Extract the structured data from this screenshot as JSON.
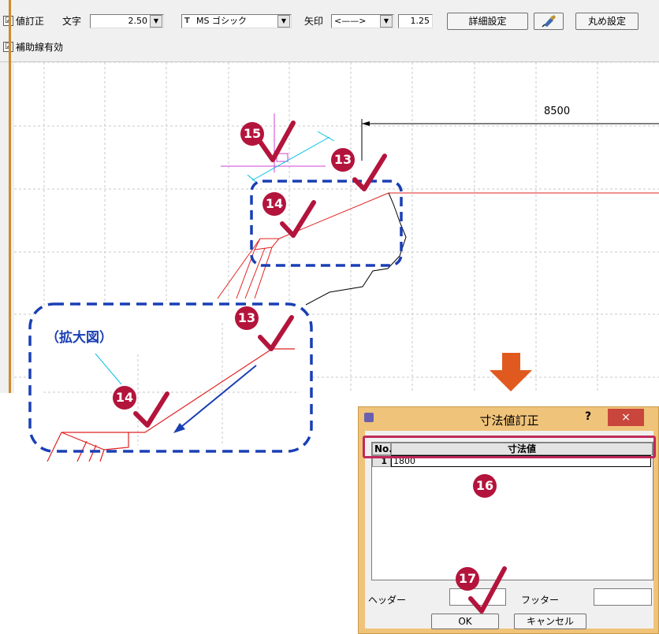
{
  "toolbar": {
    "row1": {
      "dim_correct_label": "値訂正",
      "text_label": "文字",
      "text_size_value": "2.50",
      "font_value": "MS ゴシック",
      "font_prefix": "T",
      "arrow_label": "矢印",
      "arrow_style_value": "<——>",
      "arrow_size_value": "1.25",
      "detail_settings_label": "詳細設定",
      "rounding_settings_label": "丸め設定"
    },
    "row2": {
      "aux_line_label": "補助線有効"
    },
    "checked_mark": "☑"
  },
  "drawing": {
    "dimension_value": "8500",
    "zoom_label": "（拡大図）"
  },
  "dialog": {
    "title": "寸法値訂正",
    "help_label": "?",
    "close_label": "×",
    "table_headers": {
      "no": "No.",
      "value": "寸法値"
    },
    "rows": [
      {
        "no": "1",
        "value": "1800"
      }
    ],
    "header_label": "ヘッダー",
    "footer_label": "フッター",
    "ok_label": "OK",
    "cancel_label": "キャンセル"
  },
  "steps": {
    "s13": "13",
    "s14": "14",
    "s15": "15",
    "s16": "16",
    "s17": "17"
  },
  "colors": {
    "marker": "#b3143c",
    "check": "#b3143c",
    "dashed_callout": "#1a3fb5",
    "red_line": "#e02020",
    "arrow_down": "#e05a1f"
  }
}
